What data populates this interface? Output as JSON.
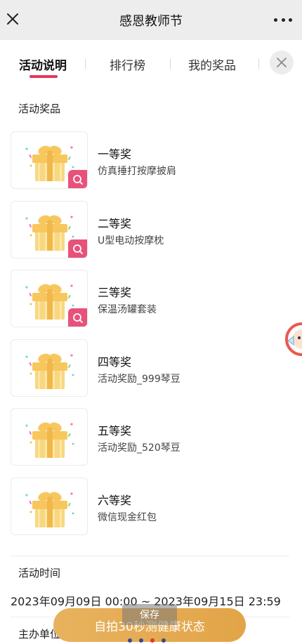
{
  "header": {
    "title": "感恩教师节",
    "close_icon": "close-icon",
    "more_icon": "more-icon"
  },
  "tabs": [
    {
      "label": "活动说明",
      "active": true
    },
    {
      "label": "排行榜",
      "active": false
    },
    {
      "label": "我的奖品",
      "active": false
    }
  ],
  "prizes_section": {
    "title": "活动奖品"
  },
  "prizes": [
    {
      "level": "一等奖",
      "name": "仿真捶打按摩披肩",
      "zoomable": true
    },
    {
      "level": "二等奖",
      "name": "U型电动按摩枕",
      "zoomable": true
    },
    {
      "level": "三等奖",
      "name": "保温汤罐套装",
      "zoomable": true
    },
    {
      "level": "四等奖",
      "name": "活动奖励_999琴豆",
      "zoomable": false
    },
    {
      "level": "五等奖",
      "name": "活动奖励_520琴豆",
      "zoomable": false
    },
    {
      "level": "六等奖",
      "name": "微信现金红包",
      "zoomable": false
    }
  ],
  "time_section": {
    "title": "活动时间",
    "value": "2023年09月09日 00:00 ~ 2023年09月15日 23:59"
  },
  "organizer_section": {
    "title": "主办单位"
  },
  "cta": {
    "label": "自拍30秒测健康状态"
  },
  "save_tip": {
    "label": "保存"
  },
  "colors": {
    "accent": "#e8335f",
    "cta": "#e2a447",
    "zoom_badge": "#e8527a"
  }
}
